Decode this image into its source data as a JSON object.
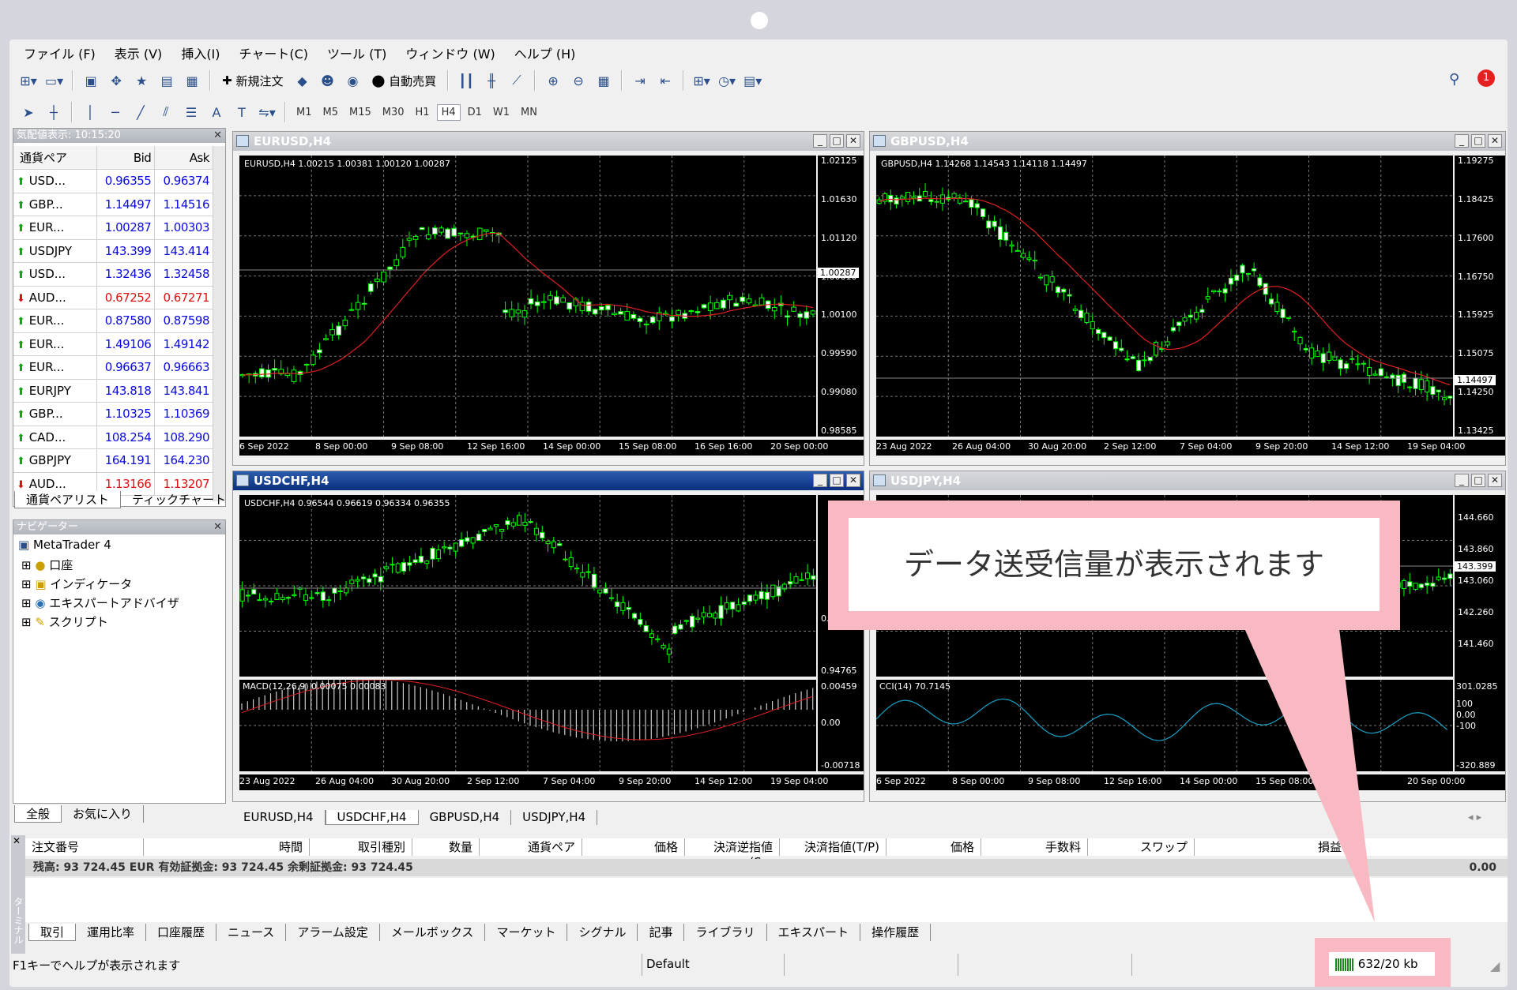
{
  "menu": [
    "ファイル (F)",
    "表示 (V)",
    "挿入(I)",
    "チャート(C)",
    "ツール (T)",
    "ウィンドウ (W)",
    "ヘルプ (H)"
  ],
  "toolbar": {
    "new_order": "新規注文",
    "auto_trading": "自動売買",
    "alert_count": "1"
  },
  "timeframes": [
    "M1",
    "M5",
    "M15",
    "M30",
    "H1",
    "H4",
    "D1",
    "W1",
    "MN"
  ],
  "active_timeframe": "H4",
  "market_watch": {
    "title": "気配値表示: 10:15:20",
    "columns": [
      "通貨ペア",
      "Bid",
      "Ask"
    ],
    "rows": [
      {
        "symbol": "USD...",
        "bid": "0.96355",
        "ask": "0.96374",
        "dir": "up"
      },
      {
        "symbol": "GBP...",
        "bid": "1.14497",
        "ask": "1.14516",
        "dir": "up"
      },
      {
        "symbol": "EUR...",
        "bid": "1.00287",
        "ask": "1.00303",
        "dir": "up"
      },
      {
        "symbol": "USDJPY",
        "bid": "143.399",
        "ask": "143.414",
        "dir": "up"
      },
      {
        "symbol": "USD...",
        "bid": "1.32436",
        "ask": "1.32458",
        "dir": "up"
      },
      {
        "symbol": "AUD...",
        "bid": "0.67252",
        "ask": "0.67271",
        "dir": "down"
      },
      {
        "symbol": "EUR...",
        "bid": "0.87580",
        "ask": "0.87598",
        "dir": "up"
      },
      {
        "symbol": "EUR...",
        "bid": "1.49106",
        "ask": "1.49142",
        "dir": "up"
      },
      {
        "symbol": "EUR...",
        "bid": "0.96637",
        "ask": "0.96663",
        "dir": "up"
      },
      {
        "symbol": "EURJPY",
        "bid": "143.818",
        "ask": "143.841",
        "dir": "up"
      },
      {
        "symbol": "GBP...",
        "bid": "1.10325",
        "ask": "1.10369",
        "dir": "up"
      },
      {
        "symbol": "CAD...",
        "bid": "108.254",
        "ask": "108.290",
        "dir": "up"
      },
      {
        "symbol": "GBPJPY",
        "bid": "164.191",
        "ask": "164.230",
        "dir": "up"
      },
      {
        "symbol": "AUD...",
        "bid": "1.13166",
        "ask": "1.13207",
        "dir": "down"
      }
    ],
    "tabs": [
      "通貨ペアリスト",
      "ティックチャート"
    ]
  },
  "navigator": {
    "title": "ナビゲーター",
    "root": "MetaTrader 4",
    "items": [
      "口座",
      "インディケータ",
      "エキスパートアドバイザ",
      "スクリプト"
    ],
    "tabs": [
      "全般",
      "お気に入り"
    ]
  },
  "charts": [
    {
      "title": "EURUSD,H4",
      "info": "EURUSD,H4  1.00215 1.00381 1.00120 1.00287",
      "prices": [
        "1.02125",
        "1.01630",
        "1.01120",
        "1.00610",
        "1.00100",
        "0.99590",
        "0.99080",
        "0.98585"
      ],
      "current": "1.00287",
      "dates": [
        "6 Sep 2022",
        "8 Sep 00:00",
        "9 Sep 08:00",
        "12 Sep 16:00",
        "14 Sep 00:00",
        "15 Sep 08:00",
        "16 Sep 16:00",
        "20 Sep 00:00"
      ]
    },
    {
      "title": "GBPUSD,H4",
      "info": "GBPUSD,H4  1.14268 1.14543 1.14118 1.14497",
      "prices": [
        "1.19275",
        "1.18425",
        "1.17600",
        "1.16750",
        "1.15925",
        "1.15075",
        "1.14250",
        "1.13425"
      ],
      "current": "1.14497",
      "dates": [
        "23 Aug 2022",
        "26 Aug 04:00",
        "30 Aug 20:00",
        "2 Sep 12:00",
        "7 Sep 04:00",
        "9 Sep 20:00",
        "14 Sep 12:00",
        "19 Sep 04:00"
      ]
    },
    {
      "title": "USDCHF,H4",
      "info": "USDCHF,H4  0.96544 0.96619 0.96334 0.96355",
      "prices": [
        "0.95640",
        "0.94765"
      ],
      "indicator": "MACD(12,26,9) 0.00075 0.00083",
      "ind_scale": [
        "0.00459",
        "0.00",
        "-0.00718"
      ],
      "dates": [
        "23 Aug 2022",
        "26 Aug 04:00",
        "30 Aug 20:00",
        "2 Sep 12:00",
        "7 Sep 04:00",
        "9 Sep 20:00",
        "14 Sep 12:00",
        "19 Sep 04:00"
      ]
    },
    {
      "title": "USDJPY,H4",
      "prices": [
        "144.660",
        "143.860",
        "143.060",
        "142.260",
        "141.460"
      ],
      "current": "143.399",
      "indicator": "CCI(14) 70.7145",
      "ind_scale": [
        "301.0285",
        "100",
        "0.00",
        "-100",
        "-320.889"
      ],
      "dates": [
        "6 Sep 2022",
        "8 Sep 00:00",
        "9 Sep 08:00",
        "12 Sep 16:00",
        "14 Sep 00:00",
        "15 Sep 08:00",
        "16:00",
        "20 Sep 00:00"
      ]
    }
  ],
  "chart_tabs": [
    "EURUSD,H4",
    "USDCHF,H4",
    "GBPUSD,H4",
    "USDJPY,H4"
  ],
  "active_chart_tab": "USDCHF,H4",
  "terminal": {
    "columns": [
      "注文番号",
      "時間",
      "取引種別",
      "数量",
      "通貨ペア",
      "価格",
      "決済逆指値(S...",
      "決済指値(T/P)",
      "価格",
      "手数料",
      "スワップ",
      "損益"
    ],
    "balance": "残高: 93 724.45 EUR  有効証拠金: 93 724.45  余剰証拠金: 93 724.45",
    "profit": "0.00",
    "tabs": [
      "取引",
      "運用比率",
      "口座履歴",
      "ニュース",
      "アラーム設定",
      "メールボックス",
      "マーケット",
      "シグナル",
      "記事",
      "ライブラリ",
      "エキスパート",
      "操作履歴"
    ],
    "side_label": "ターミナル"
  },
  "status": {
    "help": "F1キーでヘルプが表示されます",
    "profile": "Default",
    "traffic": "632/20 kb"
  },
  "callout": "データ送受信量が表示されます",
  "colors": {
    "candle": "#00ff00",
    "ma": "#e02020",
    "cci": "#1aa3c8",
    "callout": "#f8b9c2",
    "active_title": "#0a2f7e"
  }
}
